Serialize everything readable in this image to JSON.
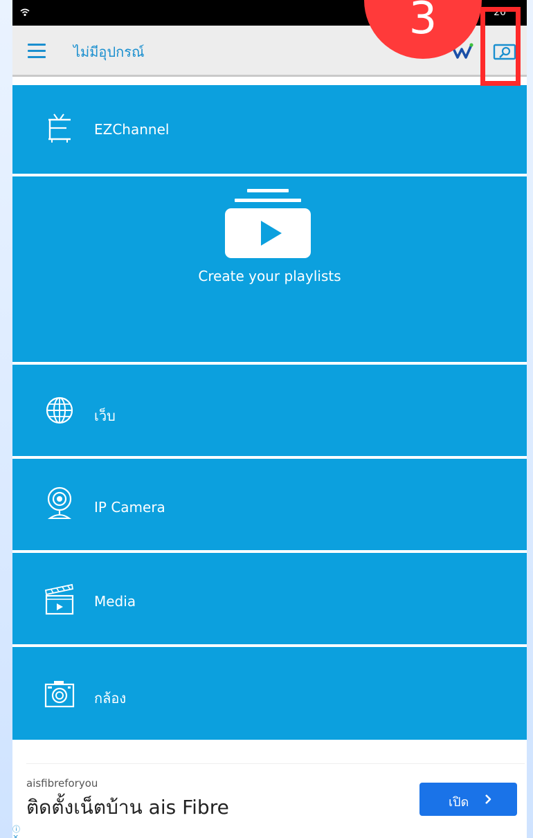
{
  "status_bar": {
    "time": "20"
  },
  "app_bar": {
    "title": "ไม่มีอุปกรณ์"
  },
  "step_badge": {
    "number": "3"
  },
  "tiles": {
    "ezchannel": {
      "label": "EZChannel"
    },
    "playlists": {
      "label": "Create your playlists"
    },
    "web": {
      "label": "เว็บ"
    },
    "ip_camera": {
      "label": "IP Camera"
    },
    "media": {
      "label": "Media"
    },
    "camera": {
      "label": "กล้อง"
    }
  },
  "ad": {
    "sponsor": "aisfibreforyou",
    "headline": "ติดตั้งเน็ตบ้าน ais Fibre",
    "cta_label": "เปิด",
    "info_glyph": "ⓘ",
    "close_glyph": "×"
  },
  "colors": {
    "tile_blue": "#0ca0de",
    "accent": "#1a8fcf",
    "highlight_red": "#ff2a2a",
    "cta_blue": "#1a73e8"
  },
  "icons": [
    "wifi-icon",
    "menu-icon",
    "w-logo-icon",
    "cast-icon",
    "tv-icon",
    "playlist-icon",
    "globe-icon",
    "webcam-icon",
    "clapperboard-icon",
    "camera-icon",
    "chevron-right-icon"
  ]
}
